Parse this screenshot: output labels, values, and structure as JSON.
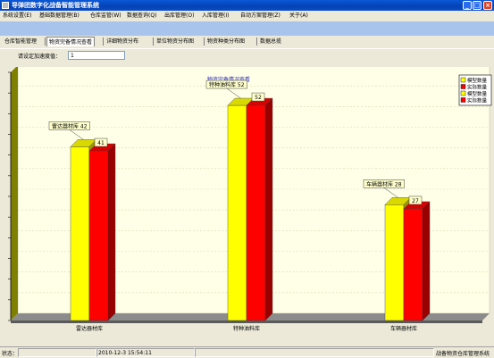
{
  "window": {
    "title": "导弹团数字化战备智能管理系统",
    "controls": [
      "_",
      "□",
      "×"
    ]
  },
  "menu": {
    "items": [
      "系统设置(E)",
      "基础数据管理(B)",
      "仓库监管(W)",
      "数据查询(Q)",
      "出库管理(O)",
      "入库管理(I)",
      "自动方案管理(Z)",
      "关于(A)"
    ]
  },
  "tabs": {
    "items": [
      "仓库智能管理",
      "物资完备情况查看",
      "详细物资分布",
      "单位物资分布图",
      "物资种类分布图",
      "数据总揽"
    ],
    "active_index": 1
  },
  "speed": {
    "label": "请设定加速度值：",
    "value": "1"
  },
  "chart_data": {
    "type": "bar",
    "title": "物资完备情况查看",
    "categories": [
      "雷达器材库",
      "特种油料库",
      "车辆器材库"
    ],
    "series": [
      {
        "name": "模型数量",
        "color": "#ffff00",
        "values": [
          42,
          52,
          28
        ]
      },
      {
        "name": "实际数量",
        "color": "#ff0000",
        "values": [
          41,
          52,
          27
        ]
      }
    ],
    "legend": [
      "模型数量",
      "实际数量",
      "模型数量",
      "实际数量"
    ],
    "legend_colors": [
      "#ffff00",
      "#ff0000",
      "#ffff00",
      "#ff0000"
    ],
    "ylim": [
      0,
      60
    ],
    "legend_position": "top-right",
    "grid": true
  },
  "status": {
    "label": "状态：",
    "datetime": "2010-12-3  15:54:11",
    "system_name": "战备物资仓库管理系统"
  },
  "colors": {
    "titlebar": "#0541b4",
    "band": "#a9c4ec",
    "plot_bg": "#ffffe8",
    "floor": "#8c8c8c",
    "wall": "#808000"
  }
}
